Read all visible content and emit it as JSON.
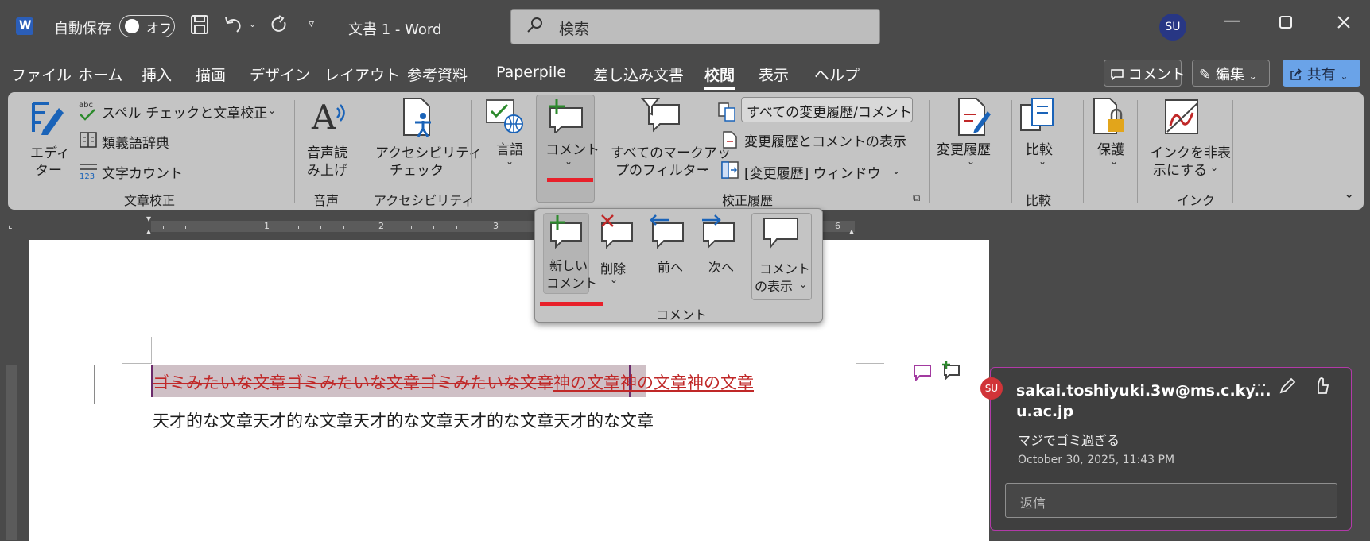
{
  "titlebar": {
    "autosave_label": "自動保存",
    "autosave_state": "オフ",
    "doc_title": "文書 1  -  Word",
    "search_placeholder": "検索",
    "user_initials": "SU"
  },
  "menu": {
    "tabs": [
      "ファイル",
      "ホーム",
      "挿入",
      "描画",
      "デザイン",
      "レイアウト",
      "参考資料",
      "Paperpile",
      "差し込み文書",
      "校閲",
      "表示",
      "ヘルプ"
    ],
    "active": "校閲",
    "comment_btn": "コメント",
    "edit_btn": "編集",
    "share_btn": "共有"
  },
  "ribbon": {
    "proofing": {
      "editor_line1": "エディ",
      "editor_line2": "ター",
      "spell": "スペル チェックと文章校正",
      "thesaurus": "類義語辞典",
      "wordcount": "文字カウント",
      "label": "文章校正"
    },
    "speech": {
      "line1": "音声読",
      "line2": "み上げ",
      "label": "音声"
    },
    "accessibility": {
      "line1": "アクセシビリティ",
      "line2": "チェック",
      "label": "アクセシビリティ"
    },
    "language": {
      "btn": "言語"
    },
    "comments": {
      "btn": "コメント"
    },
    "tracking": {
      "filter_line1": "すべてのマークアッ",
      "filter_line2": "プのフィルター",
      "display_combo": "すべての変更履歴/コメント",
      "show_markup": "変更履歴とコメントの表示",
      "pane": "[変更履歴] ウィンドウ",
      "label": "校正履歴"
    },
    "changes": {
      "btn": "変更履歴"
    },
    "compare": {
      "btn": "比較",
      "label": "比較"
    },
    "protect": {
      "btn": "保護"
    },
    "ink": {
      "line1": "インクを非表",
      "line2": "示にする",
      "label": "インク"
    }
  },
  "comments_dropdown": {
    "new_line1": "新しい",
    "new_line2": "コメント",
    "delete": "削除",
    "prev": "前へ",
    "next": "次へ",
    "show_line1": "コメント",
    "show_line2": "の表示",
    "label": "コメント"
  },
  "ruler": {
    "numbers": [
      "1",
      "2",
      "3",
      "6"
    ]
  },
  "document": {
    "deleted_text": "ゴミみたいな文章ゴミみたいな文章ゴミみたいな文章",
    "inserted_text": "神の文章神の文章神の文章",
    "line2": "天才的な文章天才的な文章天才的な文章天才的な文章天才的な文章"
  },
  "comment": {
    "initials": "SU",
    "author_line1": "sakai.toshiyuki.3w@ms.c.ky...",
    "author_line2": "u.ac.jp",
    "body": "マジでゴミ過ぎる",
    "timestamp": "October 30, 2025, 11:43 PM",
    "reply_placeholder": "返信"
  },
  "colors": {
    "accent_red": "#e8202a",
    "revision": "#c02828",
    "comment_border": "#b23aa8",
    "share_blue": "#6aa3e8"
  }
}
